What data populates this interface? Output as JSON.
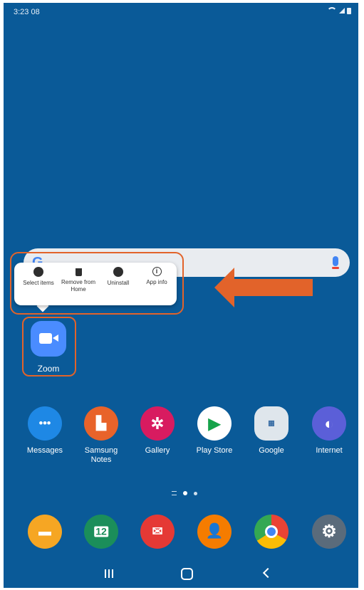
{
  "status": {
    "time": "3:23 08"
  },
  "popup": {
    "items": [
      {
        "label": "Select items",
        "icon": "check-circle-icon"
      },
      {
        "label": "Remove from Home",
        "icon": "trash-icon"
      },
      {
        "label": "Uninstall",
        "icon": "minus-circle-icon"
      },
      {
        "label": "App info",
        "icon": "info-icon"
      }
    ]
  },
  "selected_app": {
    "label": "Zoom",
    "icon": "zoom-camera-icon",
    "color": "#4a8cff"
  },
  "apps": [
    {
      "label": "Messages",
      "icon": "messages-icon",
      "color": "#1e88e5"
    },
    {
      "label": "Samsung Notes",
      "icon": "samsung-notes-icon",
      "color": "#e8632a"
    },
    {
      "label": "Gallery",
      "icon": "gallery-icon",
      "color": "#d81b60"
    },
    {
      "label": "Play Store",
      "icon": "play-store-icon",
      "color": "#ffffff"
    },
    {
      "label": "Google",
      "icon": "google-folder-icon",
      "color": "#dfe6ec"
    },
    {
      "label": "Internet",
      "icon": "internet-icon",
      "color": "#5b5fd8"
    }
  ],
  "dock": [
    {
      "icon": "my-files-icon",
      "color": "#f6a623"
    },
    {
      "icon": "calendar-icon",
      "color": "#1b8e5a",
      "text": "12"
    },
    {
      "icon": "email-icon",
      "color": "#e53935"
    },
    {
      "icon": "contacts-icon",
      "color": "#f57c00"
    },
    {
      "icon": "chrome-icon",
      "color": "#ffffff"
    },
    {
      "icon": "settings-icon",
      "color": "#5a6b7b"
    }
  ],
  "colors": {
    "wallpaper": "#0a5a98",
    "highlight": "#e2632a"
  }
}
